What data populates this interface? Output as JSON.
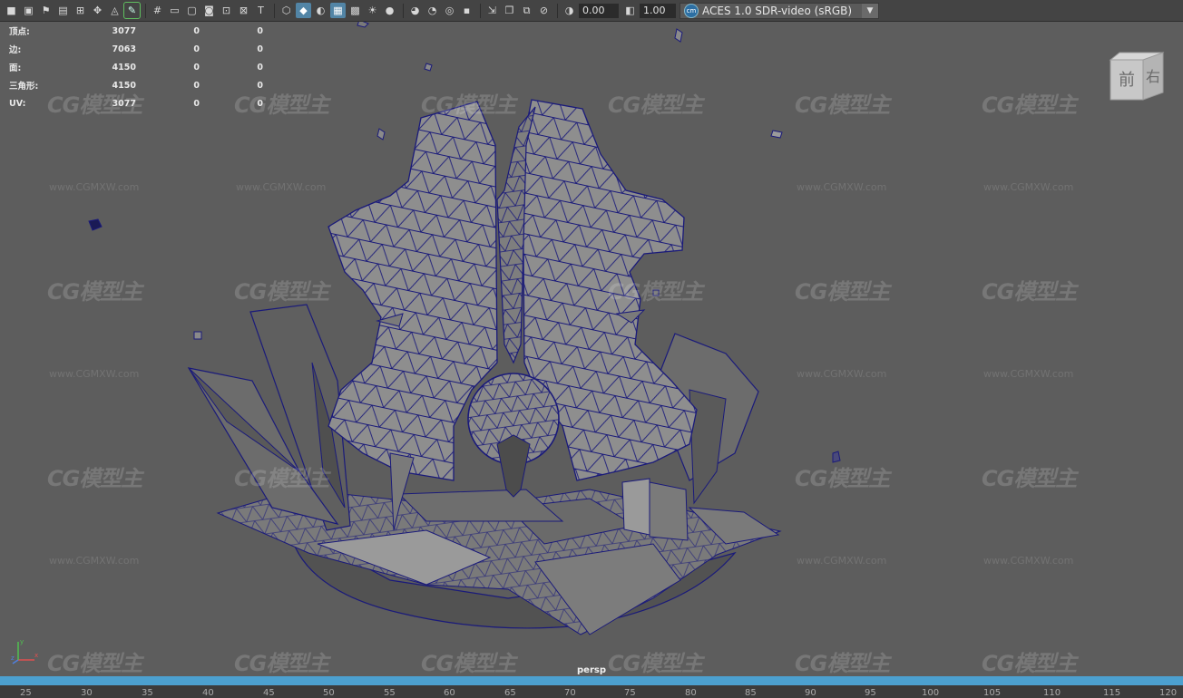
{
  "toolbar": {
    "icons_left": [
      "camera-icon",
      "camera-attr-icon",
      "bookmark-icon",
      "image-plane-icon",
      "grid-toggle-icon",
      "move-tool-icon",
      "snap-icon",
      "pencil-icon"
    ],
    "icons_mid": [
      "grid-icon",
      "film-gate-icon",
      "resolution-gate-icon",
      "gate-mask-icon",
      "field-chart-icon",
      "safe-action-icon",
      "safe-title-icon"
    ],
    "icons_shade": [
      "wireframe-icon",
      "smooth-shade-icon",
      "default-material-icon",
      "wireframe-on-shaded-icon",
      "xray-icon",
      "lights-icon",
      "shadows-icon"
    ],
    "icons_render": [
      "ssao-icon",
      "motion-blur-icon",
      "multisample-icon",
      "depth-of-field-icon"
    ],
    "icons_isolate": [
      "isolate-select-icon",
      "xray-joints-icon",
      "xray-active-icon",
      "backface-icon"
    ],
    "exposure": "0.00",
    "gamma": "1.00",
    "color_space": "ACES 1.0 SDR-video (sRGB)"
  },
  "hud": {
    "rows": [
      {
        "label": "顶点:",
        "v1": "3077",
        "v2": "0",
        "v3": "0"
      },
      {
        "label": "边:",
        "v1": "7063",
        "v2": "0",
        "v3": "0"
      },
      {
        "label": "面:",
        "v1": "4150",
        "v2": "0",
        "v3": "0"
      },
      {
        "label": "三角形:",
        "v1": "4150",
        "v2": "0",
        "v3": "0"
      },
      {
        "label": "UV:",
        "v1": "3077",
        "v2": "0",
        "v3": "0"
      }
    ]
  },
  "viewcube": {
    "front": "前",
    "right": "右"
  },
  "camera_label": "persp",
  "watermark": {
    "logo": "CG模型主",
    "url": "www.CGMXW.com"
  },
  "axis": {
    "x": "x",
    "y": "y",
    "z": "z"
  },
  "timeline": {
    "ticks": [
      "25",
      "30",
      "35",
      "40",
      "45",
      "50",
      "55",
      "60",
      "65",
      "70",
      "75",
      "80",
      "85",
      "90",
      "95",
      "100",
      "105",
      "110",
      "115",
      "120"
    ]
  },
  "colors": {
    "wire": "#1a1a7a",
    "accent": "#4ca0cf",
    "surface": "#8e8e8e"
  }
}
